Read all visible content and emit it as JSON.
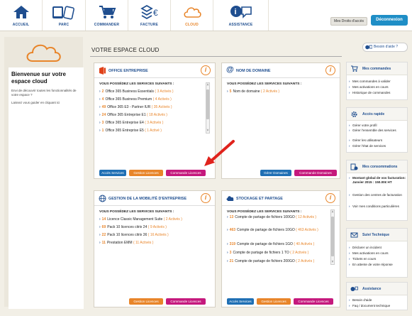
{
  "nav": {
    "items": [
      {
        "label": "ACCUEIL",
        "icon": "home-icon"
      },
      {
        "label": "PARC",
        "icon": "devices-icon"
      },
      {
        "label": "COMMANDER",
        "icon": "cart-icon"
      },
      {
        "label": "FACTURE",
        "icon": "invoice-icon"
      },
      {
        "label": "CLOUD",
        "icon": "cloud-icon"
      },
      {
        "label": "ASSISTANCE",
        "icon": "assistance-icon"
      }
    ],
    "droits_label": "Mes Droits d'accès",
    "deconnexion_label": "Déconnexion"
  },
  "welcome": {
    "title": "Bienvenue sur votre espace cloud",
    "text1": "Envi de découvrir toutes les fonctionnalités de votre espace ?",
    "text2": "Laissez vous guider en cliquant ici"
  },
  "page": {
    "title": "VOTRE ESPACE CLOUD",
    "help_label": "Besoin d'aide ?"
  },
  "cards": {
    "office": {
      "title": "OFFICE ENTREPRISE",
      "subtitle": "VOUS POSSÉDEZ LES SERVICES SUIVANTS :",
      "items": [
        {
          "num": "2",
          "name": "Office 365 Business Essentials",
          "act": "( 3 Activés )"
        },
        {
          "num": "4",
          "name": "Office 365 Business Premium",
          "act": "( 4 Activés )"
        },
        {
          "num": "49",
          "name": "Office 365 E3 - Partner IUR",
          "act": "( 35 Activés )"
        },
        {
          "num": "24",
          "name": "Office 365 Entreprise E1",
          "act": "( 18 Activés )"
        },
        {
          "num": "3",
          "name": "Office 365 Entreprise E4",
          "act": "( 3 Activés )"
        },
        {
          "num": "1",
          "name": "Office 365 Entreprise E5",
          "act": "( 1 Activé )"
        }
      ],
      "buttons": [
        "Accès Services",
        "Gestion Licences",
        "Commande Licences"
      ]
    },
    "domain": {
      "title": "NOM DE DOMAINE",
      "subtitle": "VOUS POSSÉDEZ LES SERVICES SUIVANTS :",
      "items": [
        {
          "num": "5",
          "name": "Nom de domaine",
          "act": "( 2 Activés )"
        }
      ],
      "buttons": [
        "Gérer Domaines",
        "Commande Domaines"
      ]
    },
    "mobility": {
      "title": "GESTION DE LA MOBILITÉ D'ENTREPRISE",
      "subtitle": "VOUS POSSÉDEZ LES SERVICES SUIVANTS :",
      "items": [
        {
          "num": "14",
          "name": "Licence Classic Management Suite",
          "act": "( 2 Activés )"
        },
        {
          "num": "69",
          "name": "Pack 10 licences citrix 24",
          "act": "( 9 Activés )"
        },
        {
          "num": "22",
          "name": "Pack 10 licences citrix 36",
          "act": "( 16 Activés )"
        },
        {
          "num": "11",
          "name": "Prestation EMM",
          "act": "( 11 Activés )"
        }
      ],
      "buttons": [
        "Gestion Licences",
        "Commande Licences"
      ]
    },
    "storage": {
      "title": "STOCKAGE ET PARTAGE",
      "subtitle": "VOUS POSSÉDEZ LES SERVICES SUIVANTS :",
      "items": [
        {
          "num": "13",
          "name": "Compte de partage de fichiers 100GO",
          "act": "( 12 Activés )"
        },
        {
          "num": "463",
          "name": "Compte de partage de fichiers 10GO",
          "act": "( 463 Activés )"
        },
        {
          "num": "319",
          "name": "Compte de partage de fichiers 1GO",
          "act": "( 40 Activés )"
        },
        {
          "num": "3",
          "name": "Compte de partage de fichiers 1 TO",
          "act": "( 2 Activés )"
        },
        {
          "num": "21",
          "name": "Compte de partage de fichiers 200GO",
          "act": "( 2 Activés )"
        }
      ],
      "buttons": [
        "Accès Services",
        "Gestion Licences",
        "Commande Licences"
      ]
    }
  },
  "sidebar": {
    "commandes": {
      "title": "Mes commandes",
      "links": [
        "Mes commandes à valider",
        "Mes activations en cours",
        "Historique de commandes"
      ]
    },
    "acces": {
      "title": "Accès rapide",
      "links": [
        "Gérer votre profil",
        "Gérer l'ensemble des services",
        "Gérer les utilisateurs",
        "Gérer l'état de services"
      ]
    },
    "consommations": {
      "title": "Mes consommations",
      "links": [
        "Montant global de vos facturation: Janvier 2015 : 150.00€ HT",
        "Gestion des centres de facturation",
        "Voir mes conditions particulières"
      ]
    },
    "suivi": {
      "title": "Suivi Technique",
      "links": [
        "Déclarer un incident",
        "Mes activations en cours",
        "Tickets en cours",
        "En attente de votre réponse"
      ]
    },
    "assistance": {
      "title": "Assistance",
      "links": [
        "Besoin d'aide",
        "Faq / document technique"
      ]
    }
  },
  "colors": {
    "brand_blue": "#1f4e8f",
    "accent_orange": "#e8852a",
    "pink": "#c5197d",
    "button_blue": "#1f6fb4",
    "deconnexion": "#1f8ec6",
    "arrow_red": "#e0231c"
  }
}
